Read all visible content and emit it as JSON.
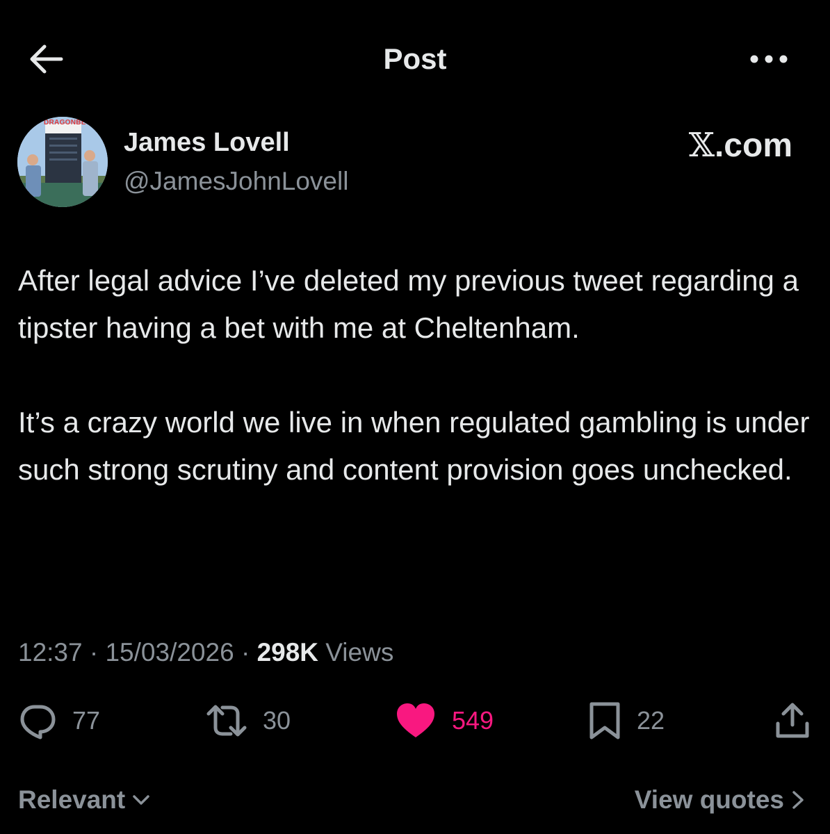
{
  "header": {
    "title": "Post",
    "back_icon": "arrow-left-icon",
    "more_icon": "more-horizontal-icon"
  },
  "author": {
    "display_name": "James Lovell",
    "handle": "@JamesJohnLovell",
    "avatar_brand": "DRAGONBET"
  },
  "site_label": {
    "x_glyph": "𝕏",
    "text": ".com"
  },
  "tweet": {
    "paragraph_1": "After legal advice I’ve deleted my previous tweet regarding a tipster having a bet with me at Cheltenham.",
    "paragraph_2": "It’s a crazy world we live in when regulated gambling is under such strong scrutiny and content provision goes unchecked."
  },
  "meta": {
    "time": "12:37",
    "separator": " · ",
    "date": "15/03/2026",
    "views_count": "298K",
    "views_label": " Views"
  },
  "actions": {
    "replies": "77",
    "reposts": "30",
    "likes": "549",
    "bookmarks": "22"
  },
  "footer": {
    "sort_label": "Relevant",
    "view_quotes_label": "View quotes"
  },
  "colors": {
    "background": "#000000",
    "text_primary": "#e7e9ea",
    "text_secondary": "#8b9299",
    "like_pink": "#f91880"
  }
}
